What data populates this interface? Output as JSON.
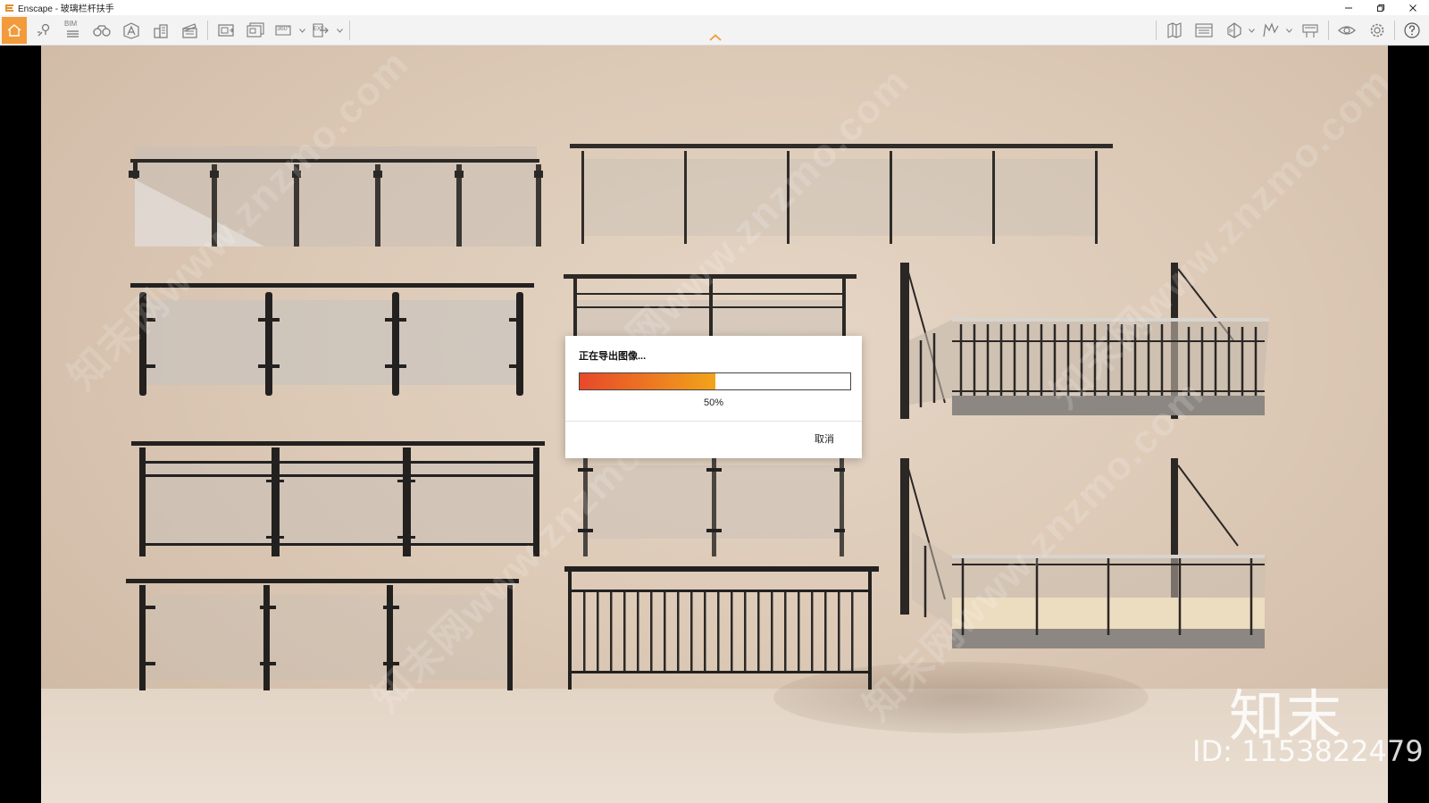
{
  "window": {
    "app_name": "Enscape",
    "title": "Enscape - 玻璃栏杆扶手",
    "brand_color": "#f39a3a"
  },
  "toolbar": {
    "bim_label": "BIM",
    "pano_label": "360°",
    "exe_label": "EXE",
    "left_icons": [
      "home-icon",
      "location-pin-icon",
      "list-icon",
      "binoculars-icon",
      "view-perspective-icon",
      "buildings-icon",
      "clapperboard-icon",
      "screenshot-icon",
      "batch-render-icon",
      "panorama-icon",
      "export-icon"
    ],
    "right_icons": [
      "map-icon",
      "bim-panel-icon",
      "orthographic-view-icon",
      "walk-mode-icon",
      "asset-library-icon",
      "visual-settings-icon",
      "settings-gear-icon",
      "help-icon"
    ]
  },
  "viewport": {
    "watermark_text": "知末网www.znzmo.com",
    "brand_logo": "知末",
    "brand_id": "ID: 1153822479"
  },
  "dialog": {
    "title": "正在导出图像...",
    "progress": 0.5,
    "progress_label": "50%",
    "cancel_label": "取消"
  }
}
